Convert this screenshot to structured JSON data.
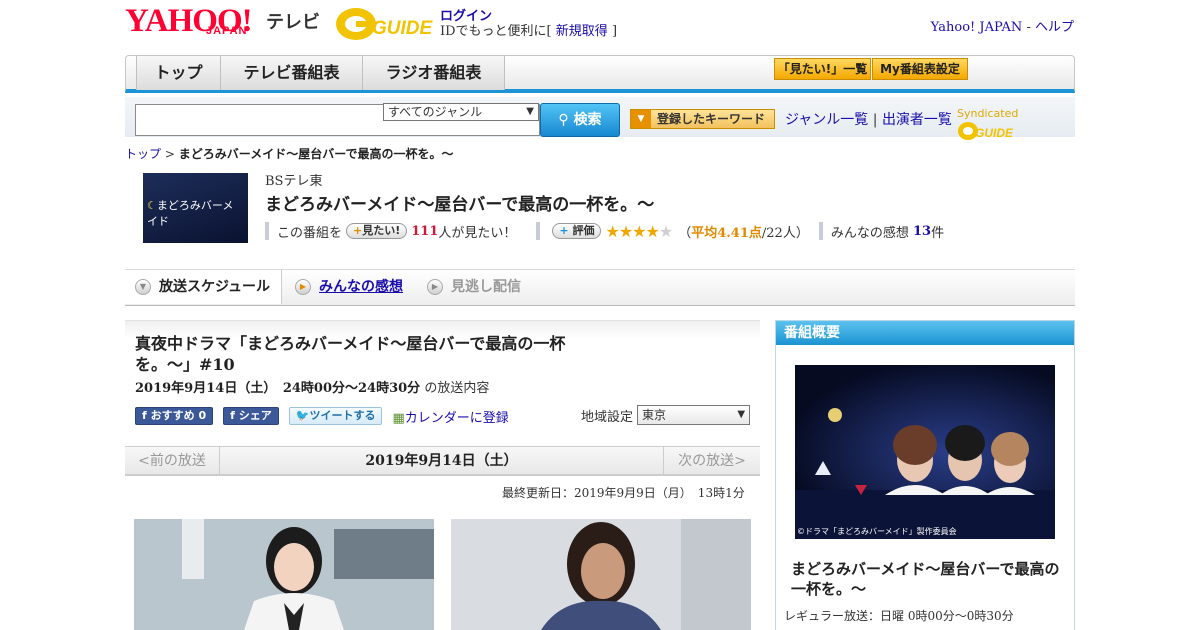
{
  "header": {
    "logo_text": "YAHOO!",
    "logo_sub": "JAPAN",
    "service_name": "テレビ",
    "gguide_logo": "GUIDE",
    "login_label": "ログイン",
    "id_prefix": "IDでもっと便利に[",
    "signup_label": "新規取得",
    "id_suffix": "]",
    "yahoo_japan_label": "Yahoo! JAPAN",
    "separator": "-",
    "help_label": "ヘルプ"
  },
  "globalnav": {
    "tabs": [
      {
        "label": "トップ"
      },
      {
        "label": "テレビ番組表"
      },
      {
        "label": "ラジオ番組表"
      }
    ],
    "watchlist_label": "「見たい!」一覧",
    "my_schedule_label": "My番組表設定"
  },
  "search": {
    "genre_value": "すべてのジャンル",
    "button_label": "検索",
    "keyword_button_label": "登録したキーワード",
    "genre_list_label": "ジャンル一覧",
    "divider": "|",
    "cast_list_label": "出演者一覧",
    "syndicated_label": "Syndicated"
  },
  "breadcrumb": {
    "top_label": "トップ",
    "separator": ">",
    "current": "まどろみバーメイド～屋台バーで最高の一杯を。～"
  },
  "program": {
    "thumb_text": "まどろみバーメイド",
    "channel": "BSテレ東",
    "title": "まどろみバーメイド～屋台バーで最高の一杯を。～",
    "want_prefix": "この番組を",
    "want_button": "見たい!",
    "want_count": "111",
    "want_suffix": "人が見たい！",
    "rate_button": "評価",
    "rating_stars": 4.41,
    "rating_open": "（",
    "rating_label": "平均4.41点",
    "rating_count": "/22人）",
    "reviews_prefix": "みんなの感想",
    "reviews_count": "13",
    "reviews_suffix": "件"
  },
  "subtabs": {
    "schedule": "放送スケジュール",
    "reviews": "みんなの感想",
    "missed": "見逃し配信"
  },
  "episode": {
    "title": "真夜中ドラマ「まどろみバーメイド～屋台バーで最高の一杯を。～」#10",
    "datetime": "2019年9月14日（土）　24時00分～24時30分",
    "datetime_suffix": "の放送内容",
    "fb_recommend": "おすすめ 0",
    "fb_share": "シェア",
    "tweet": "ツイートする",
    "calendar": "カレンダーに登録",
    "region_label": "地域設定",
    "region_value": "東京"
  },
  "datenav": {
    "prev": "<前の放送",
    "current": "2019年9月14日（土）",
    "next": "次の放送>"
  },
  "updated": "最終更新日：2019年9月9日（月）　13時1分",
  "sidebar": {
    "heading": "番組概要",
    "credit": "©ドラマ「まどろみバーメイド」製作委員会",
    "title": "まどろみバーメイド～屋台バーで最高の一杯を。～",
    "regular": "レギュラー放送：日曜 0時00分～0時30分"
  },
  "colors": {
    "brand_red": "#ff0033",
    "nav_blue": "#1d94d6",
    "link": "#1a0dab",
    "star": "#f0a800"
  }
}
